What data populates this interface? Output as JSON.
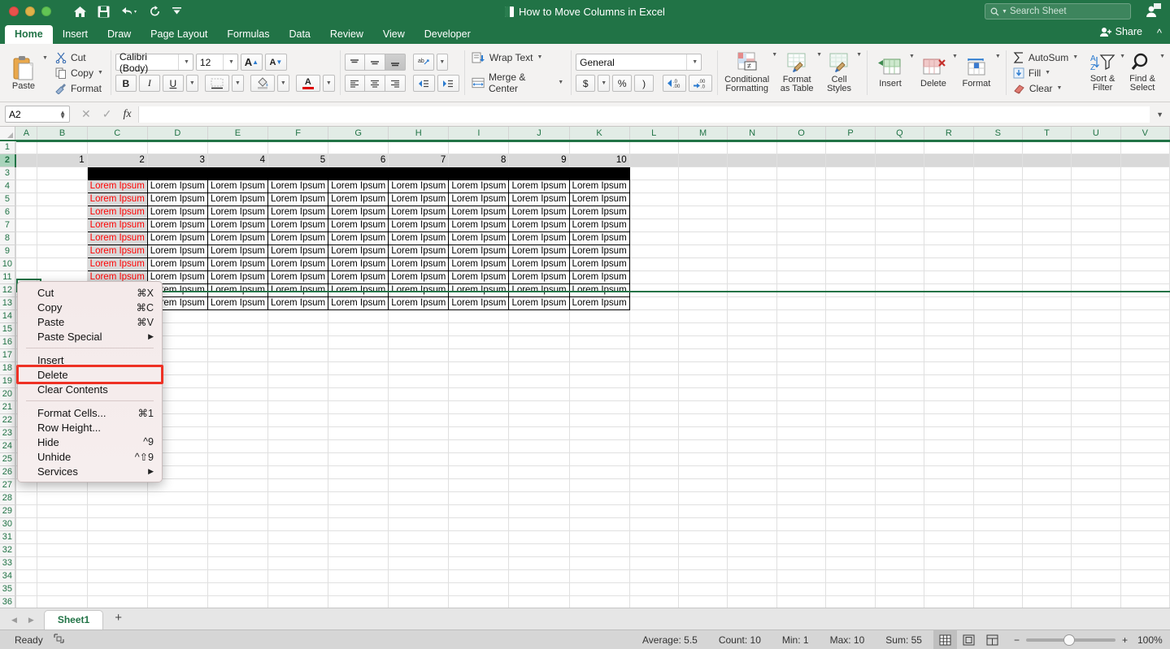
{
  "titlebar": {
    "document_title": "How to Move Columns in Excel",
    "quick_access": [
      {
        "name": "home-icon",
        "label": "Home"
      },
      {
        "name": "save-icon",
        "label": "Save"
      },
      {
        "name": "undo-icon",
        "label": "Undo"
      },
      {
        "name": "redo-icon",
        "label": "Redo"
      },
      {
        "name": "customize-toolbar-icon",
        "label": "Customize"
      }
    ],
    "search_placeholder": "Search Sheet"
  },
  "tabs": {
    "items": [
      "Home",
      "Insert",
      "Draw",
      "Page Layout",
      "Formulas",
      "Data",
      "Review",
      "View",
      "Developer"
    ],
    "active": "Home",
    "share_label": "Share"
  },
  "ribbon": {
    "clipboard": {
      "paste_label": "Paste",
      "cut_label": "Cut",
      "copy_label": "Copy",
      "format_label": "Format"
    },
    "font": {
      "family": "Calibri (Body)",
      "size": "12",
      "grow_label": "A",
      "shrink_label": "A",
      "bold_label": "B",
      "italic_label": "I",
      "underline_label": "U"
    },
    "alignment": {
      "wrap_text_label": "Wrap Text",
      "merge_center_label": "Merge & Center"
    },
    "number": {
      "format": "General",
      "currency_label": "$",
      "percent_label": "%",
      "comma_label": ")"
    },
    "styles": {
      "conditional_formatting_label": "Conditional\nFormatting",
      "conditional_formatting_l1": "Conditional",
      "conditional_formatting_l2": "Formatting",
      "format_as_table_l1": "Format",
      "format_as_table_l2": "as Table",
      "cell_styles_l1": "Cell",
      "cell_styles_l2": "Styles"
    },
    "cells": {
      "insert_label": "Insert",
      "delete_label": "Delete",
      "format_label": "Format"
    },
    "editing": {
      "autosum_label": "AutoSum",
      "fill_label": "Fill",
      "clear_label": "Clear",
      "sort_filter_l1": "Sort &",
      "sort_filter_l2": "Filter",
      "find_select_l1": "Find &",
      "find_select_l2": "Select"
    }
  },
  "formula_bar": {
    "name_box": "A2",
    "formula_value": "",
    "cancel_label": "✕",
    "enter_label": "✓",
    "fx_label": "fx"
  },
  "grid": {
    "column_headers": [
      "A",
      "B",
      "C",
      "D",
      "E",
      "F",
      "G",
      "H",
      "I",
      "J",
      "K",
      "L",
      "M",
      "N",
      "O",
      "P",
      "Q",
      "R",
      "S",
      "T",
      "U",
      "V"
    ],
    "selected_column_range": [
      "A",
      "B",
      "C",
      "D",
      "E",
      "F",
      "G",
      "H",
      "I",
      "J",
      "K",
      "L",
      "M",
      "N",
      "O",
      "P",
      "Q",
      "R",
      "S",
      "T",
      "U",
      "V"
    ],
    "row_headers": [
      1,
      2,
      3,
      4,
      5,
      6,
      7,
      8,
      9,
      10,
      11,
      12,
      13,
      14,
      15,
      16,
      17,
      18,
      19,
      20,
      21,
      22,
      23,
      24,
      25,
      26,
      27,
      28,
      29,
      30,
      31,
      32,
      33,
      34,
      35,
      36
    ],
    "selected_row": 2,
    "row2_values": [
      "",
      "1",
      "2",
      "3",
      "4",
      "5",
      "6",
      "7",
      "8",
      "9",
      "10"
    ],
    "row3_is_black_fill": true,
    "data_cell_text": "Lorem Ipsum",
    "data_rows": [
      4,
      5,
      6,
      7,
      8,
      9,
      10,
      11,
      12,
      13
    ],
    "data_columns": [
      "C",
      "D",
      "E",
      "F",
      "G",
      "H",
      "I",
      "J",
      "K"
    ],
    "red_text_column": "C",
    "red_text_color": "#ff0000"
  },
  "context_menu": {
    "items": [
      {
        "label": "Cut",
        "shortcut": "⌘X",
        "submenu": false
      },
      {
        "label": "Copy",
        "shortcut": "⌘C",
        "submenu": false
      },
      {
        "label": "Paste",
        "shortcut": "⌘V",
        "submenu": false
      },
      {
        "label": "Paste Special",
        "shortcut": "",
        "submenu": true
      },
      {
        "separator": true
      },
      {
        "label": "Insert",
        "shortcut": "",
        "submenu": false
      },
      {
        "label": "Delete",
        "shortcut": "",
        "submenu": false,
        "highlighted": true
      },
      {
        "label": "Clear Contents",
        "shortcut": "",
        "submenu": false
      },
      {
        "separator": true
      },
      {
        "label": "Format Cells...",
        "shortcut": "⌘1",
        "submenu": false
      },
      {
        "label": "Row Height...",
        "shortcut": "",
        "submenu": false
      },
      {
        "label": "Hide",
        "shortcut": "^9",
        "submenu": false
      },
      {
        "label": "Unhide",
        "shortcut": "^⇧9",
        "submenu": false
      },
      {
        "label": "Services",
        "shortcut": "",
        "submenu": true
      }
    ],
    "highlight_color": "#ee3124"
  },
  "sheet_tabs": {
    "tabs": [
      "Sheet1"
    ],
    "active": "Sheet1",
    "add_label": "+"
  },
  "status_bar": {
    "state": "Ready",
    "average": "Average: 5.5",
    "count": "Count: 10",
    "min": "Min: 1",
    "max": "Max: 10",
    "sum": "Sum: 55",
    "zoom": "100%",
    "zoom_out_label": "−",
    "zoom_in_label": "+"
  },
  "theme": {
    "excel_green": "#217346",
    "highlight_red": "#ee3124",
    "selection_gray": "#d9d9d9"
  }
}
